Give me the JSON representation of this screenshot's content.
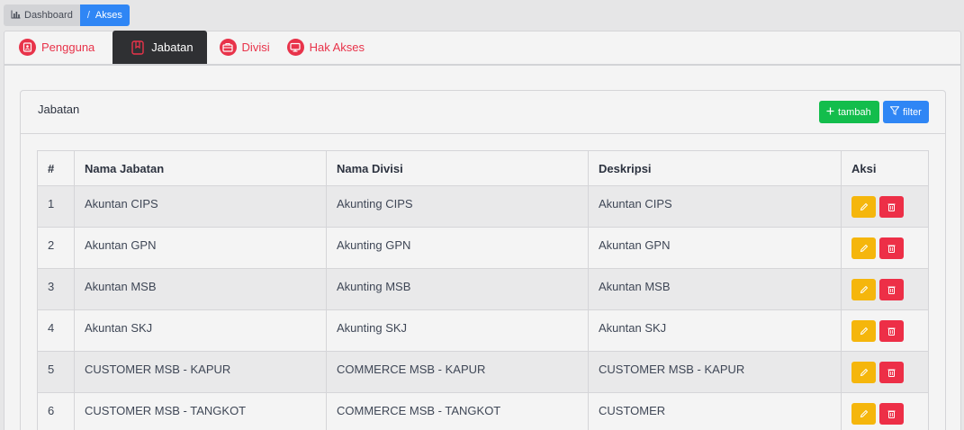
{
  "breadcrumb": {
    "home_label": "Dashboard",
    "separator": "/",
    "current_label": "Akses"
  },
  "tabs": [
    {
      "label": "Pengguna",
      "icon": "user-badge-icon",
      "active": false
    },
    {
      "label": "Jabatan",
      "icon": "bookmark-icon",
      "active": true
    },
    {
      "label": "Divisi",
      "icon": "briefcase-icon",
      "active": false
    },
    {
      "label": "Hak Akses",
      "icon": "monitor-icon",
      "active": false
    }
  ],
  "card": {
    "title": "Jabatan",
    "add_label": "tambah",
    "filter_label": "filter"
  },
  "table": {
    "headers": [
      "#",
      "Nama Jabatan",
      "Nama Divisi",
      "Deskripsi",
      "Aksi"
    ],
    "rows": [
      {
        "num": "1",
        "jabatan": "Akuntan CIPS",
        "divisi": "Akunting CIPS",
        "deskripsi": "Akuntan CIPS"
      },
      {
        "num": "2",
        "jabatan": "Akuntan GPN",
        "divisi": "Akunting GPN",
        "deskripsi": "Akuntan GPN"
      },
      {
        "num": "3",
        "jabatan": "Akuntan MSB",
        "divisi": "Akunting MSB",
        "deskripsi": "Akuntan MSB"
      },
      {
        "num": "4",
        "jabatan": "Akuntan SKJ",
        "divisi": "Akunting SKJ",
        "deskripsi": "Akuntan SKJ"
      },
      {
        "num": "5",
        "jabatan": "CUSTOMER MSB - KAPUR",
        "divisi": "COMMERCE MSB - KAPUR",
        "deskripsi": "CUSTOMER MSB - KAPUR"
      },
      {
        "num": "6",
        "jabatan": "CUSTOMER MSB - TANGKOT",
        "divisi": "COMMERCE MSB - TANGKOT",
        "deskripsi": "CUSTOMER"
      }
    ]
  },
  "colors": {
    "accent_red": "#e8334a",
    "primary_blue": "#2f86f5",
    "success_green": "#13bd4c",
    "warning_yellow": "#f5b60c",
    "danger_red": "#ed2f47",
    "active_tab": "#2f3033"
  }
}
